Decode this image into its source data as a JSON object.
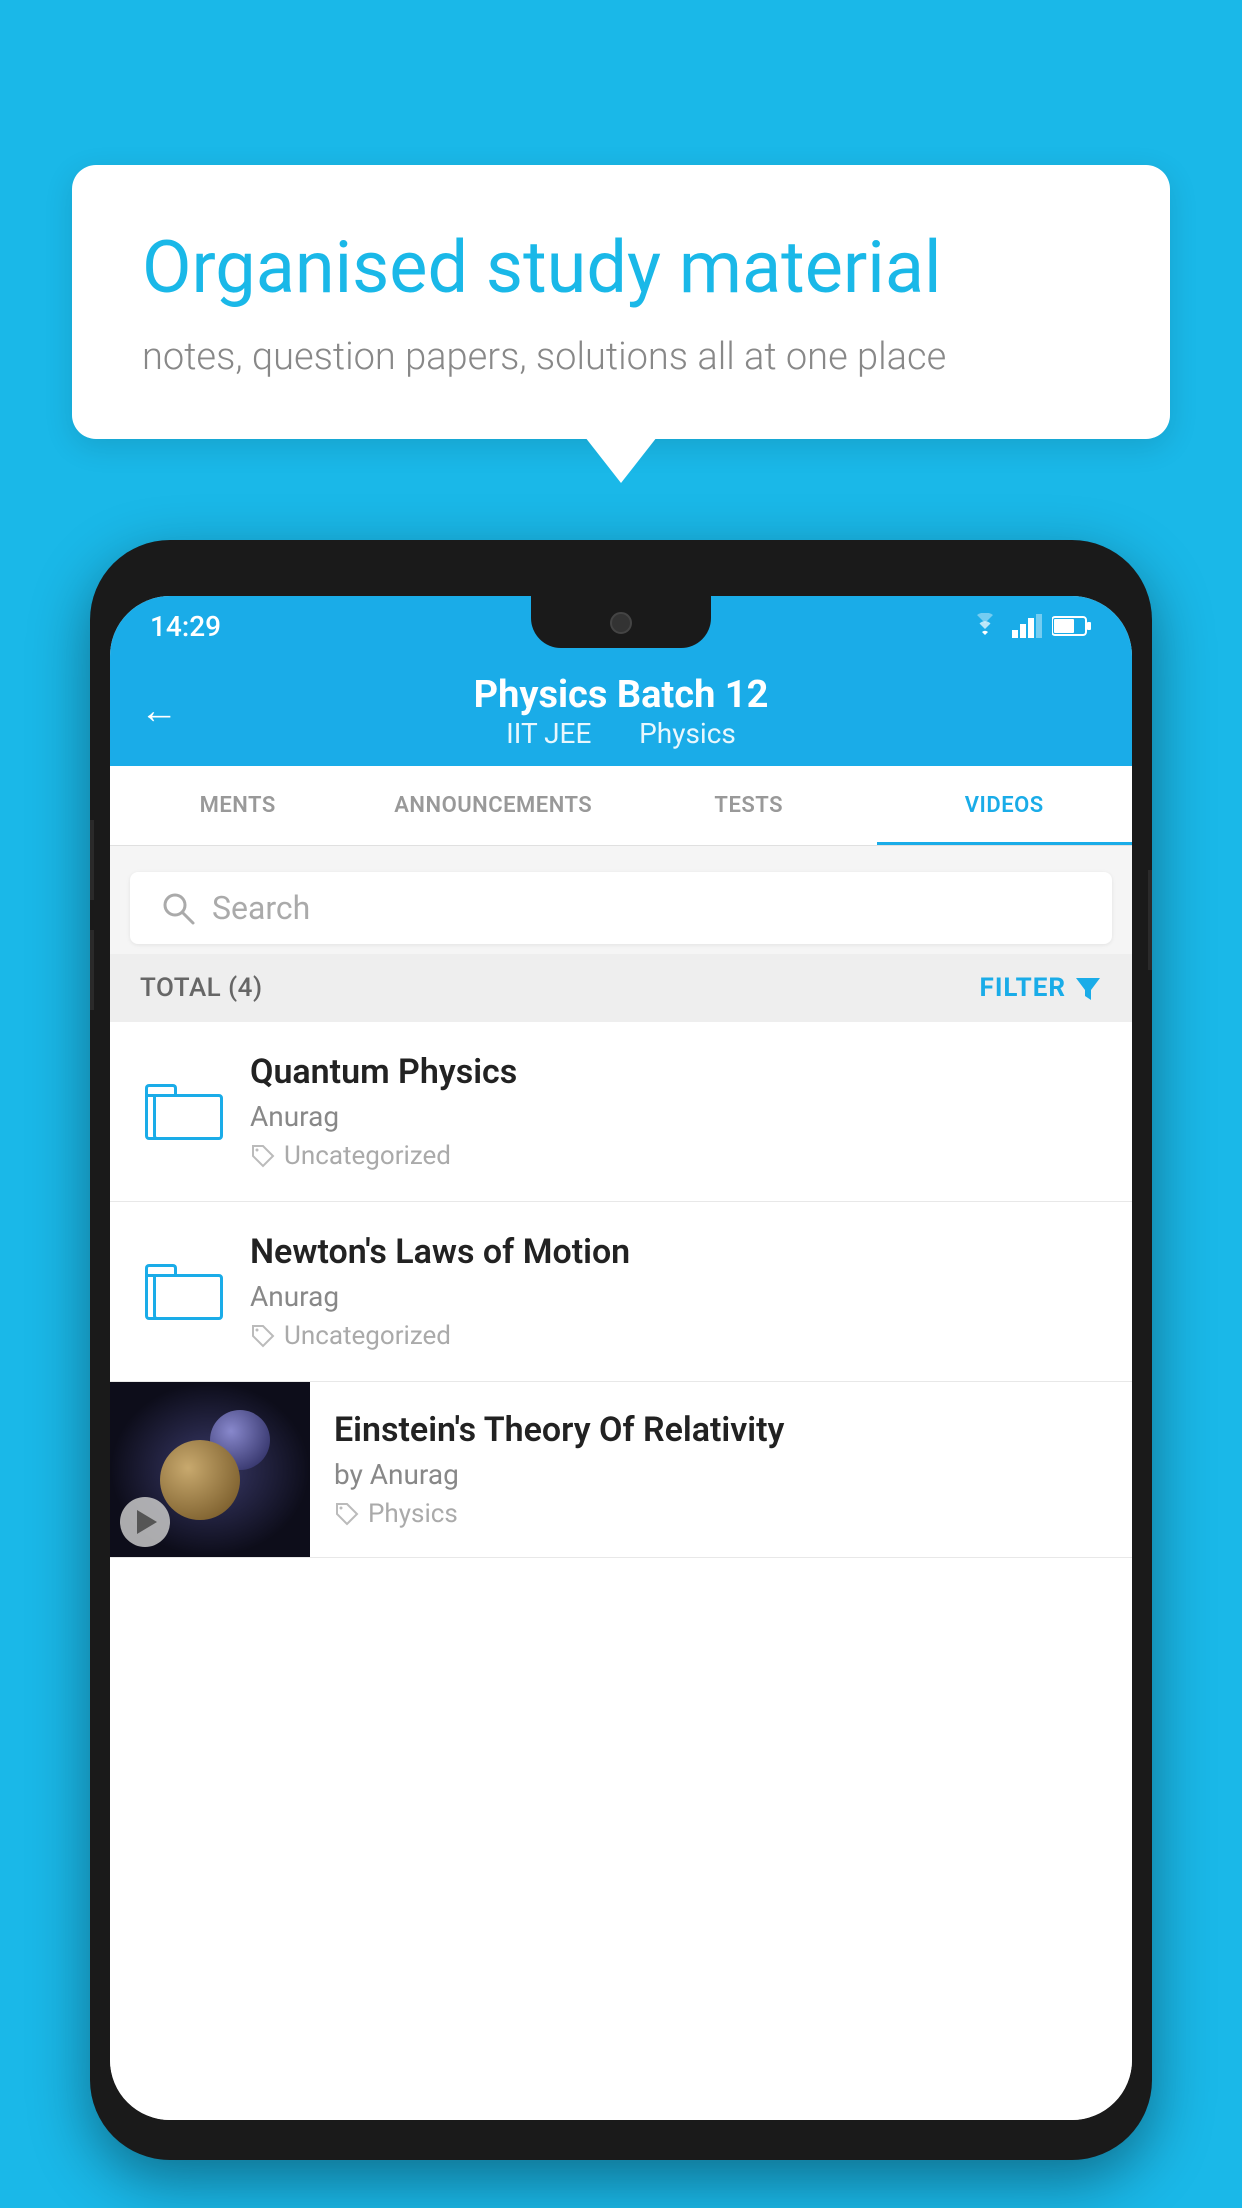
{
  "background_color": "#1ab8e8",
  "bubble": {
    "title": "Organised study material",
    "subtitle": "notes, question papers, solutions all at one place"
  },
  "status_bar": {
    "time": "14:29"
  },
  "header": {
    "title": "Physics Batch 12",
    "subtitle_left": "IIT JEE",
    "subtitle_right": "Physics",
    "back_label": "←"
  },
  "tabs": [
    {
      "label": "MENTS",
      "active": false
    },
    {
      "label": "ANNOUNCEMENTS",
      "active": false
    },
    {
      "label": "TESTS",
      "active": false
    },
    {
      "label": "VIDEOS",
      "active": true
    }
  ],
  "search": {
    "placeholder": "Search"
  },
  "filter": {
    "total_label": "TOTAL (4)",
    "filter_label": "FILTER"
  },
  "videos": [
    {
      "title": "Quantum Physics",
      "author": "Anurag",
      "tag": "Uncategorized",
      "has_thumbnail": false
    },
    {
      "title": "Newton's Laws of Motion",
      "author": "Anurag",
      "tag": "Uncategorized",
      "has_thumbnail": false
    },
    {
      "title": "Einstein's Theory Of Relativity",
      "author": "by Anurag",
      "tag": "Physics",
      "has_thumbnail": true
    }
  ]
}
